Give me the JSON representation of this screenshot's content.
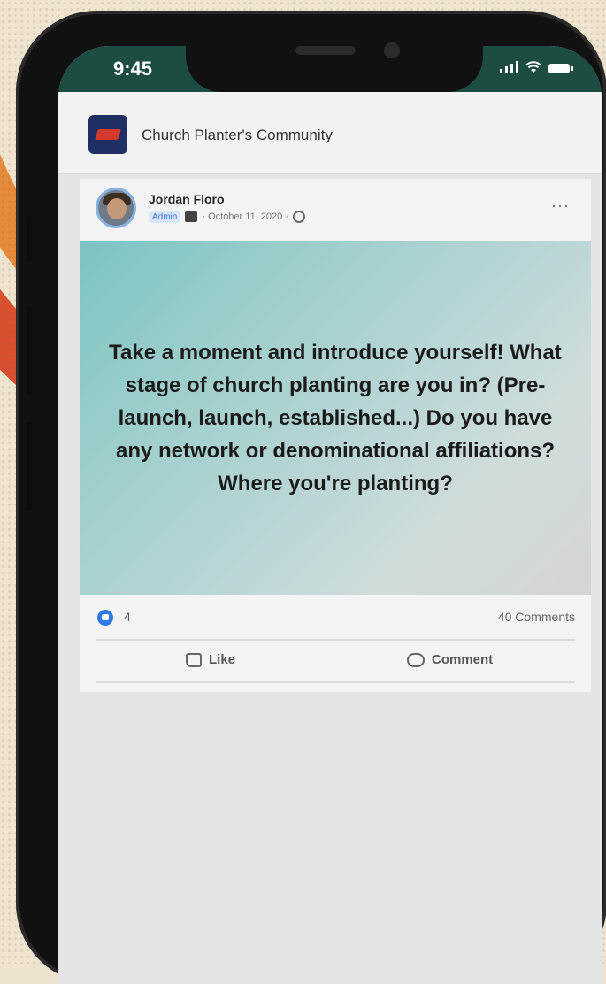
{
  "status": {
    "time": "9:45"
  },
  "group": {
    "name": "Church Planter's Community"
  },
  "post": {
    "author": "Jordan Floro",
    "role": "Admin",
    "date": "· October 11, 2020 ·",
    "more": "···",
    "body": "Take a moment and introduce yourself! What stage of church planting are you in? (Pre-launch, launch, established...) Do you have any network or denominational affiliations? Where you're planting?",
    "reactions_count": "4",
    "comments_count": "40 Comments"
  },
  "actions": {
    "like": "Like",
    "comment": "Comment"
  },
  "colors": {
    "status_bar": "#1d4d42",
    "reaction_blue": "#2f78e5",
    "group_logo": "#1f2f63"
  },
  "icons": [
    "signal-icon",
    "wifi-icon",
    "battery-icon",
    "globe-icon",
    "more-icon",
    "like-icon",
    "comment-icon"
  ]
}
